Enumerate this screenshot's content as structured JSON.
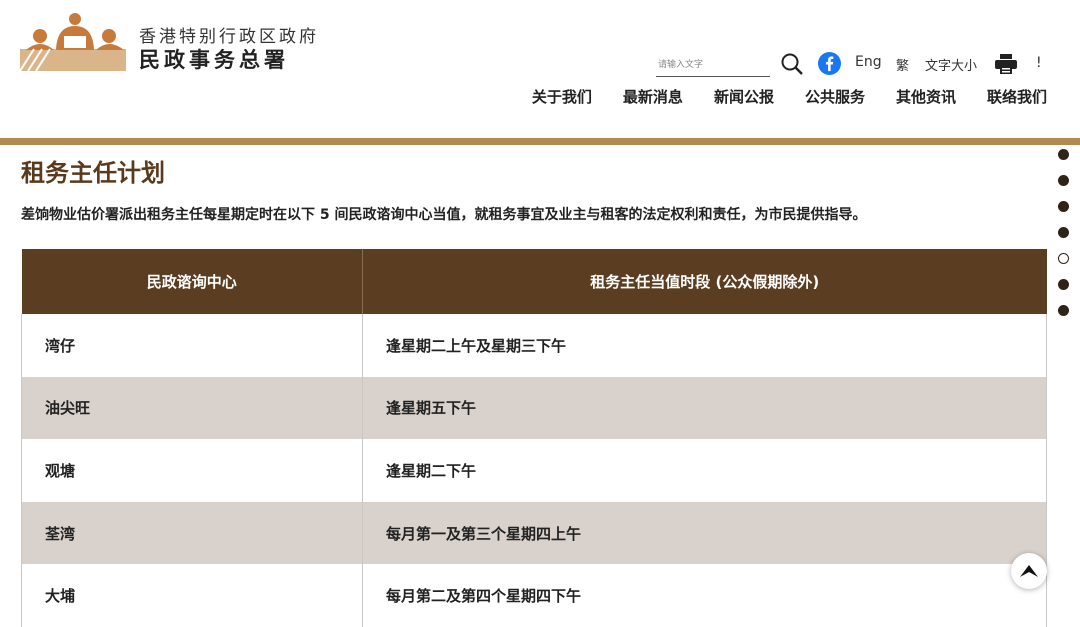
{
  "header": {
    "org_line1": "香港特别行政区政府",
    "org_line2": "民政事务总署",
    "search_placeholder": "请输入文字",
    "lang_en": "Eng",
    "lang_tc": "繁",
    "font_size": "文字大小",
    "alert": "!",
    "icons": [
      "search-icon",
      "facebook-icon",
      "print-icon"
    ]
  },
  "nav": [
    "关于我们",
    "最新消息",
    "新闻公报",
    "公共服务",
    "其他资讯",
    "联络我们"
  ],
  "page": {
    "title": "租务主任计划",
    "intro": "差饷物业估价署派出租务主任每星期定时在以下 5 间民政谘询中心当值，就租务事宜及业主与租客的法定权利和责任，为市民提供指导。"
  },
  "table": {
    "headers": [
      "民政谘询中心",
      "租务主任当值时段 (公众假期除外)"
    ],
    "rows": [
      [
        "湾仔",
        "逢星期二上午及星期三下午"
      ],
      [
        "油尖旺",
        "逢星期五下午"
      ],
      [
        "观塘",
        "逢星期二下午"
      ],
      [
        "荃湾",
        "每月第一及第三个星期四上午"
      ],
      [
        "大埔",
        "每月第二及第四个星期四下午"
      ]
    ]
  },
  "side_dots": {
    "count": 7,
    "active_index": 4
  },
  "colors": {
    "brand_brown": "#5b3e22",
    "accent_gold": "#b08a4e",
    "row_alt": "#d9d1cb",
    "logo_orange": "#c87a3c",
    "logo_tan": "#dbb58a"
  }
}
